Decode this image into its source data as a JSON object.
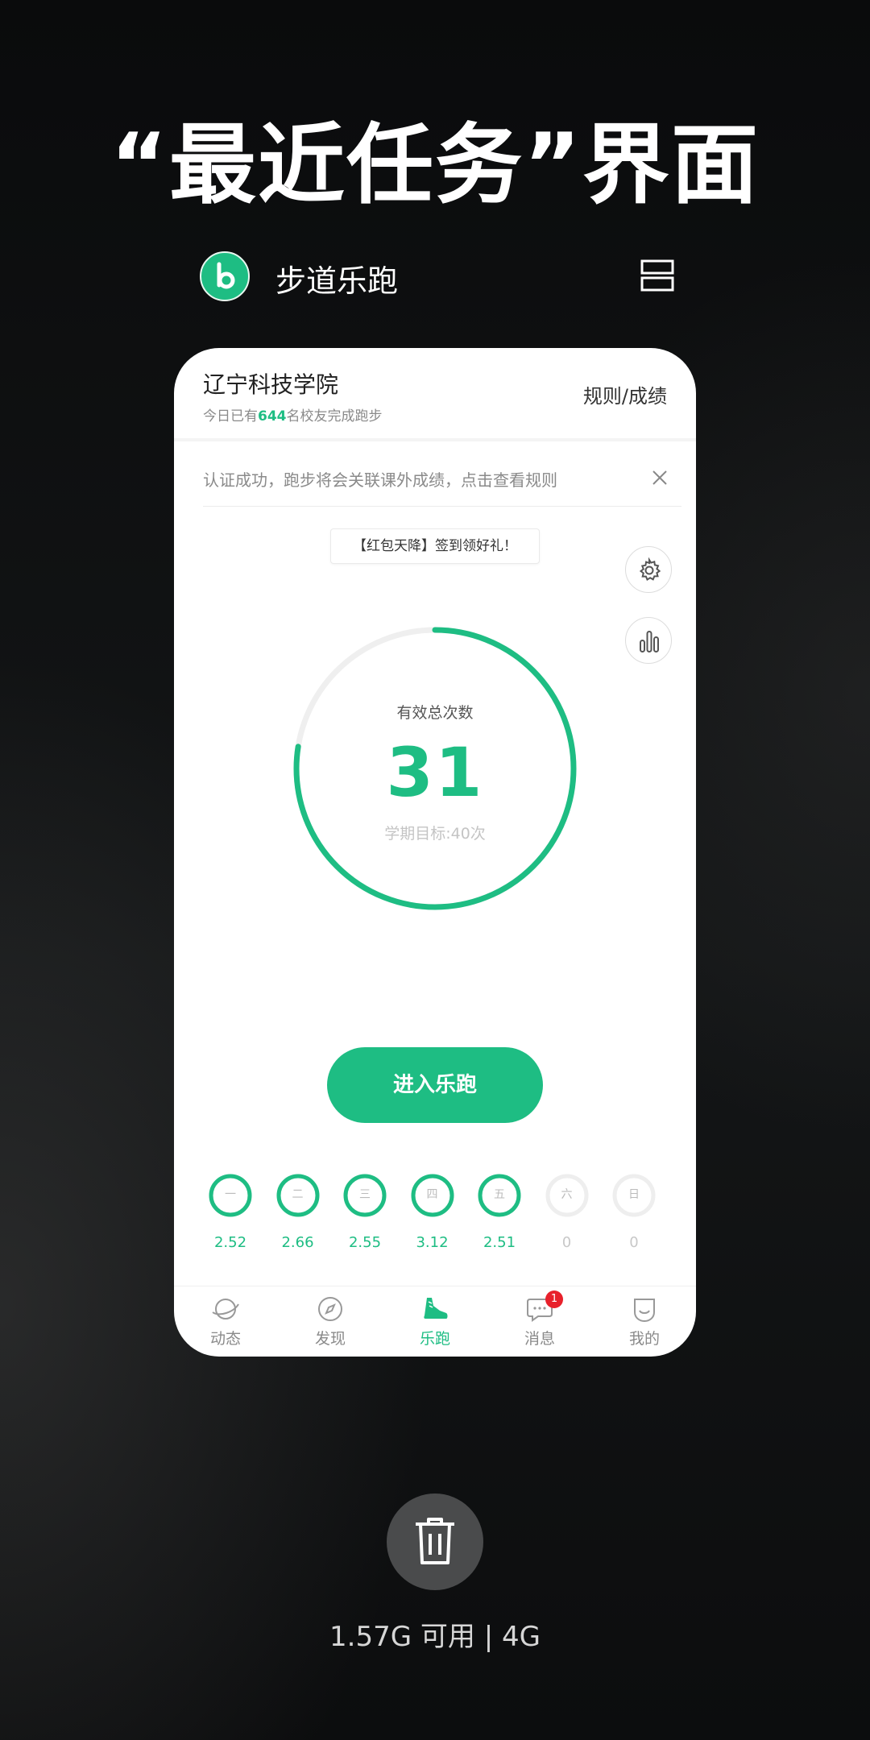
{
  "headline": "“最近任务”界面",
  "app": {
    "name": "步道乐跑",
    "logo_letter": "b"
  },
  "card": {
    "school": "辽宁科技学院",
    "sub_prefix": "今日已有",
    "sub_count": "644",
    "sub_suffix": "名校友完成跑步",
    "rules_link": "规则/成绩",
    "notice": "认证成功，跑步将会关联课外成绩，点击查看规则",
    "promo": "【红包天降】签到领好礼！",
    "progress": {
      "label": "有效总次数",
      "value": "31",
      "target_label": "学期目标:40次",
      "current": 31,
      "goal": 40
    },
    "run_button": "进入乐跑",
    "week": [
      {
        "day": "一",
        "distance": "2.52",
        "done": true
      },
      {
        "day": "二",
        "distance": "2.66",
        "done": true
      },
      {
        "day": "三",
        "distance": "2.55",
        "done": true
      },
      {
        "day": "四",
        "distance": "3.12",
        "done": true
      },
      {
        "day": "五",
        "distance": "2.51",
        "done": true
      },
      {
        "day": "六",
        "distance": "0",
        "done": false
      },
      {
        "day": "日",
        "distance": "0",
        "done": false
      }
    ],
    "tabs": [
      {
        "label": "动态",
        "icon": "planet-icon"
      },
      {
        "label": "发现",
        "icon": "compass-icon"
      },
      {
        "label": "乐跑",
        "icon": "sneaker-icon",
        "active": true
      },
      {
        "label": "消息",
        "icon": "chat-bubble-icon",
        "badge": "1"
      },
      {
        "label": "我的",
        "icon": "smile-face-icon"
      }
    ]
  },
  "memory_info": "1.57G 可用 | 4G",
  "colors": {
    "accent": "#1ebd83",
    "badge": "#e8212b",
    "background": "#0d0f10"
  }
}
